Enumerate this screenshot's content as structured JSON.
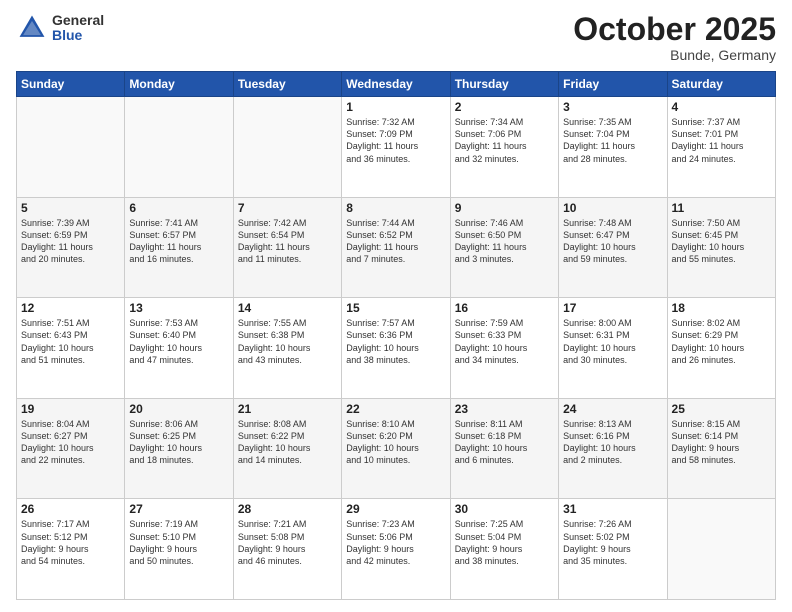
{
  "header": {
    "logo_general": "General",
    "logo_blue": "Blue",
    "month": "October 2025",
    "location": "Bunde, Germany"
  },
  "days_of_week": [
    "Sunday",
    "Monday",
    "Tuesday",
    "Wednesday",
    "Thursday",
    "Friday",
    "Saturday"
  ],
  "weeks": [
    [
      {
        "day": "",
        "info": ""
      },
      {
        "day": "",
        "info": ""
      },
      {
        "day": "",
        "info": ""
      },
      {
        "day": "1",
        "info": "Sunrise: 7:32 AM\nSunset: 7:09 PM\nDaylight: 11 hours\nand 36 minutes."
      },
      {
        "day": "2",
        "info": "Sunrise: 7:34 AM\nSunset: 7:06 PM\nDaylight: 11 hours\nand 32 minutes."
      },
      {
        "day": "3",
        "info": "Sunrise: 7:35 AM\nSunset: 7:04 PM\nDaylight: 11 hours\nand 28 minutes."
      },
      {
        "day": "4",
        "info": "Sunrise: 7:37 AM\nSunset: 7:01 PM\nDaylight: 11 hours\nand 24 minutes."
      }
    ],
    [
      {
        "day": "5",
        "info": "Sunrise: 7:39 AM\nSunset: 6:59 PM\nDaylight: 11 hours\nand 20 minutes."
      },
      {
        "day": "6",
        "info": "Sunrise: 7:41 AM\nSunset: 6:57 PM\nDaylight: 11 hours\nand 16 minutes."
      },
      {
        "day": "7",
        "info": "Sunrise: 7:42 AM\nSunset: 6:54 PM\nDaylight: 11 hours\nand 11 minutes."
      },
      {
        "day": "8",
        "info": "Sunrise: 7:44 AM\nSunset: 6:52 PM\nDaylight: 11 hours\nand 7 minutes."
      },
      {
        "day": "9",
        "info": "Sunrise: 7:46 AM\nSunset: 6:50 PM\nDaylight: 11 hours\nand 3 minutes."
      },
      {
        "day": "10",
        "info": "Sunrise: 7:48 AM\nSunset: 6:47 PM\nDaylight: 10 hours\nand 59 minutes."
      },
      {
        "day": "11",
        "info": "Sunrise: 7:50 AM\nSunset: 6:45 PM\nDaylight: 10 hours\nand 55 minutes."
      }
    ],
    [
      {
        "day": "12",
        "info": "Sunrise: 7:51 AM\nSunset: 6:43 PM\nDaylight: 10 hours\nand 51 minutes."
      },
      {
        "day": "13",
        "info": "Sunrise: 7:53 AM\nSunset: 6:40 PM\nDaylight: 10 hours\nand 47 minutes."
      },
      {
        "day": "14",
        "info": "Sunrise: 7:55 AM\nSunset: 6:38 PM\nDaylight: 10 hours\nand 43 minutes."
      },
      {
        "day": "15",
        "info": "Sunrise: 7:57 AM\nSunset: 6:36 PM\nDaylight: 10 hours\nand 38 minutes."
      },
      {
        "day": "16",
        "info": "Sunrise: 7:59 AM\nSunset: 6:33 PM\nDaylight: 10 hours\nand 34 minutes."
      },
      {
        "day": "17",
        "info": "Sunrise: 8:00 AM\nSunset: 6:31 PM\nDaylight: 10 hours\nand 30 minutes."
      },
      {
        "day": "18",
        "info": "Sunrise: 8:02 AM\nSunset: 6:29 PM\nDaylight: 10 hours\nand 26 minutes."
      }
    ],
    [
      {
        "day": "19",
        "info": "Sunrise: 8:04 AM\nSunset: 6:27 PM\nDaylight: 10 hours\nand 22 minutes."
      },
      {
        "day": "20",
        "info": "Sunrise: 8:06 AM\nSunset: 6:25 PM\nDaylight: 10 hours\nand 18 minutes."
      },
      {
        "day": "21",
        "info": "Sunrise: 8:08 AM\nSunset: 6:22 PM\nDaylight: 10 hours\nand 14 minutes."
      },
      {
        "day": "22",
        "info": "Sunrise: 8:10 AM\nSunset: 6:20 PM\nDaylight: 10 hours\nand 10 minutes."
      },
      {
        "day": "23",
        "info": "Sunrise: 8:11 AM\nSunset: 6:18 PM\nDaylight: 10 hours\nand 6 minutes."
      },
      {
        "day": "24",
        "info": "Sunrise: 8:13 AM\nSunset: 6:16 PM\nDaylight: 10 hours\nand 2 minutes."
      },
      {
        "day": "25",
        "info": "Sunrise: 8:15 AM\nSunset: 6:14 PM\nDaylight: 9 hours\nand 58 minutes."
      }
    ],
    [
      {
        "day": "26",
        "info": "Sunrise: 7:17 AM\nSunset: 5:12 PM\nDaylight: 9 hours\nand 54 minutes."
      },
      {
        "day": "27",
        "info": "Sunrise: 7:19 AM\nSunset: 5:10 PM\nDaylight: 9 hours\nand 50 minutes."
      },
      {
        "day": "28",
        "info": "Sunrise: 7:21 AM\nSunset: 5:08 PM\nDaylight: 9 hours\nand 46 minutes."
      },
      {
        "day": "29",
        "info": "Sunrise: 7:23 AM\nSunset: 5:06 PM\nDaylight: 9 hours\nand 42 minutes."
      },
      {
        "day": "30",
        "info": "Sunrise: 7:25 AM\nSunset: 5:04 PM\nDaylight: 9 hours\nand 38 minutes."
      },
      {
        "day": "31",
        "info": "Sunrise: 7:26 AM\nSunset: 5:02 PM\nDaylight: 9 hours\nand 35 minutes."
      },
      {
        "day": "",
        "info": ""
      }
    ]
  ]
}
